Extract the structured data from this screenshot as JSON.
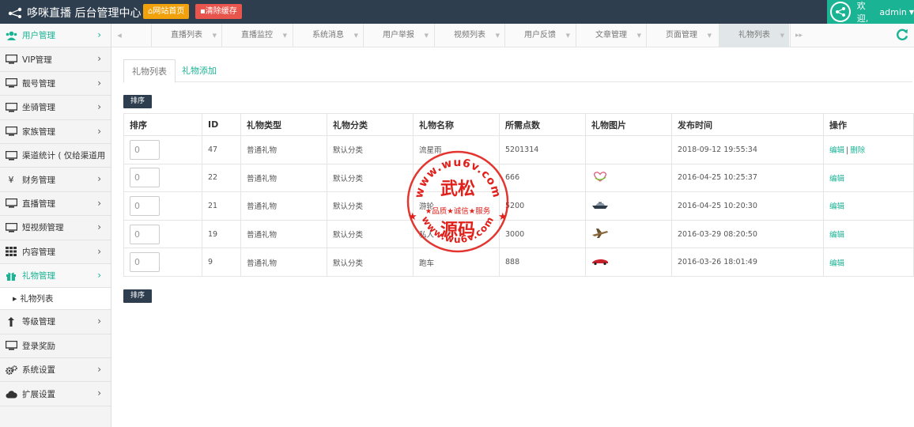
{
  "header": {
    "title": "哆咪直播 后台管理中心",
    "home_button": "网站首页",
    "cache_button": "清除缓存",
    "welcome": "欢迎,",
    "username": "admin"
  },
  "sidebar": {
    "items": [
      {
        "label": "用户管理",
        "icon": "users-icon",
        "active": true
      },
      {
        "label": "VIP管理",
        "icon": "monitor-icon"
      },
      {
        "label": "靓号管理",
        "icon": "monitor-icon"
      },
      {
        "label": "坐骑管理",
        "icon": "monitor-icon"
      },
      {
        "label": "家族管理",
        "icon": "monitor-icon"
      },
      {
        "label": "渠道统计 ( 仅给渠道用",
        "icon": "monitor-icon"
      },
      {
        "label": "财务管理",
        "icon": "yen-icon"
      },
      {
        "label": "直播管理",
        "icon": "monitor-icon"
      },
      {
        "label": "短视频管理",
        "icon": "monitor-icon"
      },
      {
        "label": "内容管理",
        "icon": "grid-icon"
      },
      {
        "label": "礼物管理",
        "icon": "gift-icon",
        "active": true
      }
    ],
    "sub_item": "礼物列表",
    "items_after": [
      {
        "label": "等级管理",
        "icon": "level-up-icon"
      },
      {
        "label": "登录奖励",
        "icon": "monitor-icon"
      },
      {
        "label": "系统设置",
        "icon": "gears-icon"
      },
      {
        "label": "扩展设置",
        "icon": "cloud-icon"
      }
    ]
  },
  "tabs": [
    "直播列表",
    "直播监控",
    "系统消息",
    "用户举报",
    "视频列表",
    "用户反馈",
    "文章管理",
    "页面管理",
    "礼物列表"
  ],
  "active_tab": "礼物列表",
  "content": {
    "subtab_active": "礼物列表",
    "subtab_add": "礼物添加",
    "sort_button": "排序",
    "table": {
      "headers": [
        "排序",
        "ID",
        "礼物类型",
        "礼物分类",
        "礼物名称",
        "所需点数",
        "礼物图片",
        "发布时间",
        "操作"
      ],
      "rows": [
        {
          "order": "0",
          "id": "47",
          "type": "普通礼物",
          "category": "默认分类",
          "name": "流星雨",
          "points": "5201314",
          "image": "",
          "time": "2018-09-12 19:55:34",
          "edit": "编辑",
          "delete": "删除",
          "sep": "|"
        },
        {
          "order": "0",
          "id": "22",
          "type": "普通礼物",
          "category": "默认分类",
          "name": "",
          "points": "666",
          "image": "heart-gift-image",
          "time": "2016-04-25 10:25:37",
          "edit": "编辑"
        },
        {
          "order": "0",
          "id": "21",
          "type": "普通礼物",
          "category": "默认分类",
          "name": "游轮",
          "points": "5200",
          "image": "yacht-gift-image",
          "time": "2016-04-25 10:20:30",
          "edit": "编辑"
        },
        {
          "order": "0",
          "id": "19",
          "type": "普通礼物",
          "category": "默认分类",
          "name": "私人",
          "points": "3000",
          "image": "plane-gift-image",
          "time": "2016-03-29 08:20:50",
          "edit": "编辑"
        },
        {
          "order": "0",
          "id": "9",
          "type": "普通礼物",
          "category": "默认分类",
          "name": "跑车",
          "points": "888",
          "image": "sportscar-gift-image",
          "time": "2016-03-26 18:01:49",
          "edit": "编辑"
        }
      ]
    }
  },
  "watermark": {
    "url_top": "www.wu6v.com",
    "url_bottom": "www.wu6v.com",
    "line1": "武松",
    "slogan": "★品质★诚信★服务",
    "line2": "源码",
    "color": "#e0201b"
  },
  "colors": {
    "accent": "#1ab394",
    "header_bg": "#2e3e4e",
    "home_btn": "#f0a10b",
    "cache_btn": "#e8554d"
  }
}
